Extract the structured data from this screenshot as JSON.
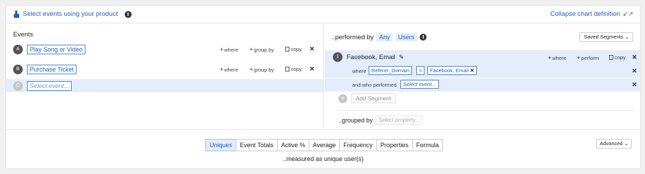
{
  "topbar": {
    "select_label": "Select events using your product",
    "collapse_label": "Collapse chart definition"
  },
  "events": {
    "heading": "Events",
    "rows": [
      {
        "letter": "A",
        "name": "Play Song or Video"
      },
      {
        "letter": "B",
        "name": "Purchase Ticket"
      },
      {
        "letter": "C",
        "placeholder": "Select event..."
      }
    ],
    "actions": {
      "where": "where",
      "group_by": "group by",
      "copy": "copy"
    }
  },
  "performed": {
    "prefix": "..performed by",
    "any": "Any",
    "users": "Users",
    "saved_segments": "Saved Segments",
    "segment": {
      "number": "1",
      "name": "Facebook, Email",
      "actions": {
        "where": "where",
        "perform": "perform",
        "copy": "copy"
      },
      "where_label": "where",
      "property": "Referer_Domain",
      "operator": "=",
      "value": "Facebook, Email",
      "who_label": "and who performed",
      "who_placeholder": "Select event..."
    },
    "add_segment": "Add Segment",
    "grouped_label": "..grouped by",
    "grouped_placeholder": "Select property..."
  },
  "measure": {
    "tabs": [
      "Uniques",
      "Event Totals",
      "Active %",
      "Average",
      "Frequency",
      "Properties",
      "Formula"
    ],
    "selected": "Uniques",
    "caption": "..measured as unique user(s)",
    "advanced": "Advanced"
  }
}
